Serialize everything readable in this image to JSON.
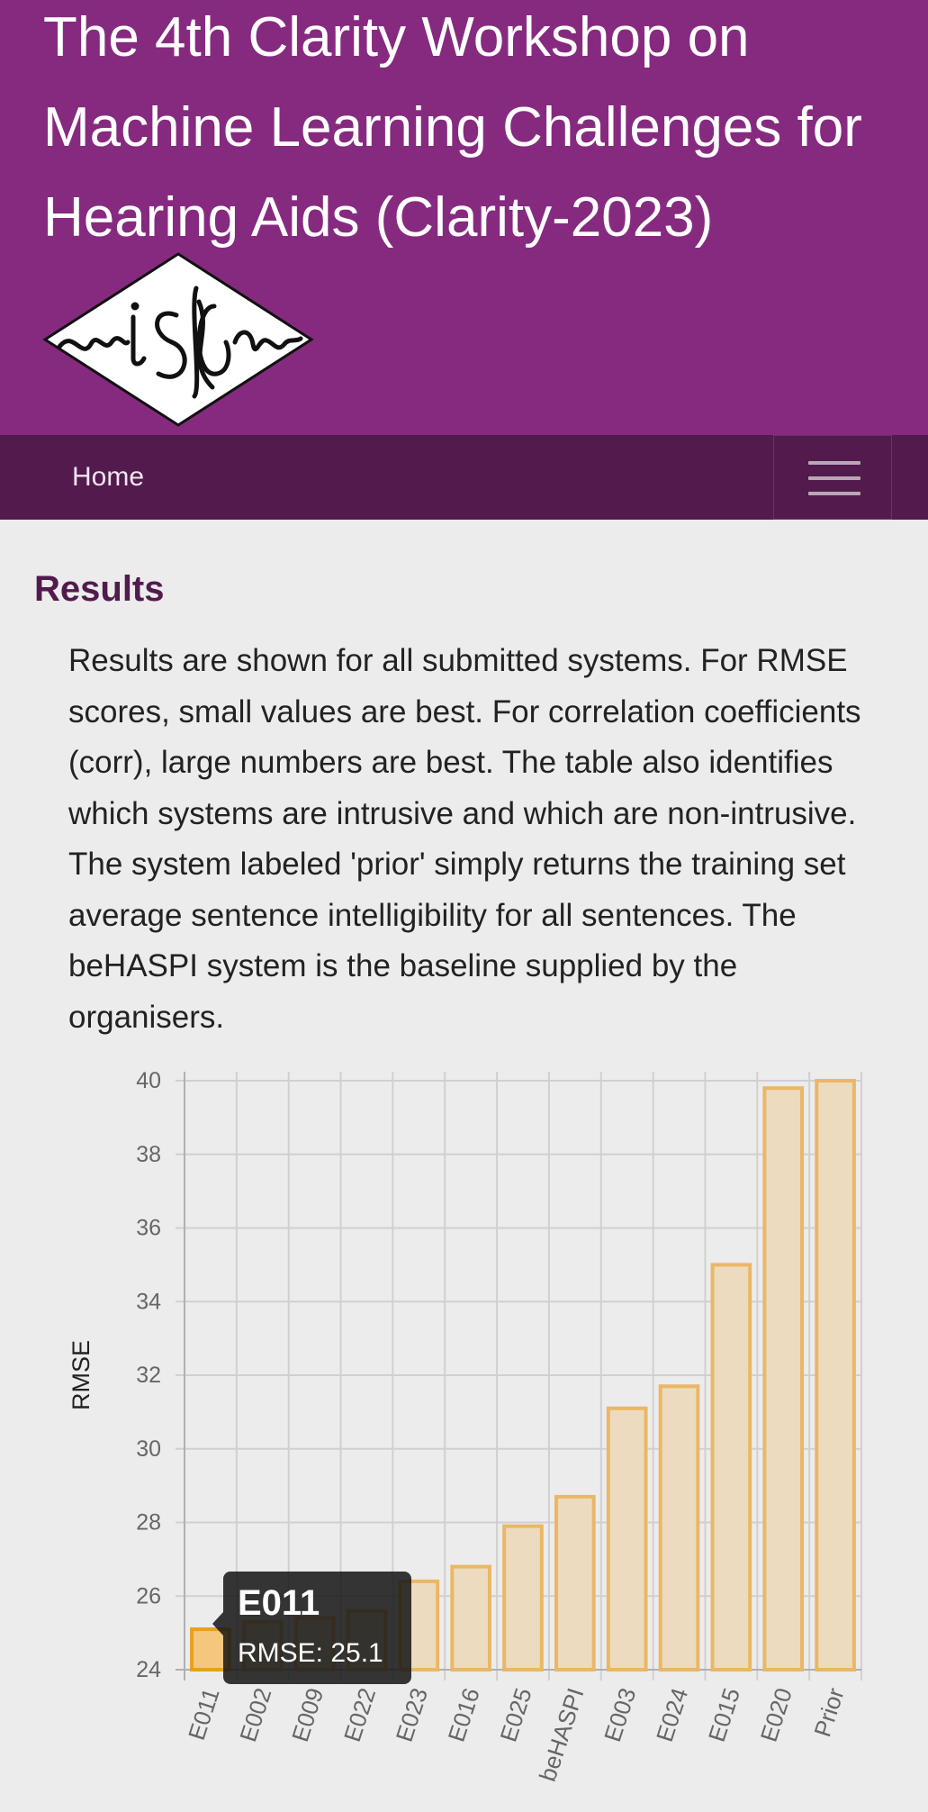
{
  "header": {
    "title": "The 4th Clarity Workshop on Machine Learning Challenges for Hearing Aids (Clarity-2023)",
    "logo_alt": "isca",
    "brand_color": "#862a80"
  },
  "nav": {
    "home_label": "Home",
    "menu_icon": "hamburger-menu-icon",
    "color": "#521a4d"
  },
  "main": {
    "heading": "Results",
    "intro": "Results are shown for all submitted systems. For RMSE scores, small values are best. For correlation coefficients (corr), large numbers are best. The table also identifies which systems are intrusive and which are non-intrusive. The system labeled 'prior' simply returns the training set average sentence intelligibility for all sentences. The beHASPI system is the baseline supplied by the organisers."
  },
  "chart_data": {
    "type": "bar",
    "ylabel": "RMSE",
    "xlabel": "",
    "ylim": [
      24,
      40
    ],
    "yticks": [
      24,
      26,
      28,
      30,
      32,
      34,
      36,
      38,
      40
    ],
    "grid": true,
    "categories": [
      "E011",
      "E002",
      "E009",
      "E022",
      "E023",
      "E016",
      "E025",
      "beHASPI",
      "E003",
      "E024",
      "E015",
      "E020",
      "Prior"
    ],
    "values": [
      25.1,
      25.3,
      25.4,
      25.6,
      26.4,
      26.8,
      27.9,
      28.7,
      31.1,
      31.7,
      35.0,
      39.8,
      40.0
    ],
    "bar_fill": "#ecdbbe",
    "bar_stroke": "#eab766",
    "highlight_fill": "#f5c67e",
    "highlight_stroke": "#e8a021",
    "tooltip": {
      "title": "E011",
      "label": "RMSE: 25.1"
    }
  }
}
